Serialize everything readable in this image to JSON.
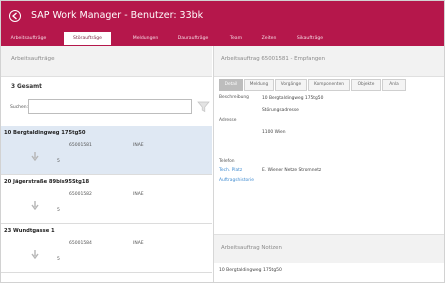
{
  "app": {
    "title": "SAP Work Manager - Benutzer: 33bk",
    "brand_color": "#b5174b"
  },
  "nav": {
    "tabs": [
      {
        "label": "Arbeitsaufträge"
      },
      {
        "label": "Störaufträge"
      },
      {
        "label": "Meldungen"
      },
      {
        "label": "Dauraufträge"
      },
      {
        "label": "Team"
      },
      {
        "label": "Zeiten"
      },
      {
        "label": "Sikaufträge"
      }
    ]
  },
  "left": {
    "header": "Arbeitsaufträge",
    "count": "3 Gesamt",
    "search_label": "Suchen:",
    "search_value": "",
    "items": [
      {
        "title": "10 Bergtaldingweg 175tg50",
        "number": "65001581",
        "status": "INAE",
        "priority": "5"
      },
      {
        "title": "20 Jägerstraße 89bis95Stg18",
        "number": "65001582",
        "status": "INAE",
        "priority": "5"
      },
      {
        "title": "23 Wundtgasse 1",
        "number": "65001584",
        "status": "INAE",
        "priority": "5"
      }
    ]
  },
  "right": {
    "header": "Arbeitsauftrag 65001581 - Empfangen",
    "detail_tabs": [
      {
        "label": "Detail"
      },
      {
        "label": "Meldung"
      },
      {
        "label": "Vorgänge"
      },
      {
        "label": "Komponenten"
      },
      {
        "label": "Objekte"
      },
      {
        "label": "Anla"
      }
    ],
    "fields": {
      "beschreibung_label": "Beschreibung",
      "beschreibung_value": "10 Bergtaldingweg 175tg50",
      "adresse_label": "Adresse",
      "adresse_line1": "Störungsadresse",
      "adresse_line2": "1100 Wien",
      "telefon_label": "Telefon",
      "techplatz_label": "Tech. Platz",
      "techplatz_value": "E. Wiener Netze Stromnetz",
      "auftragshistorie_label": "Auftragshistorie"
    },
    "notes_header": "Arbeitsauftrag Notizen",
    "notes_text": "10 Bergtaldingweg 175tg50"
  }
}
